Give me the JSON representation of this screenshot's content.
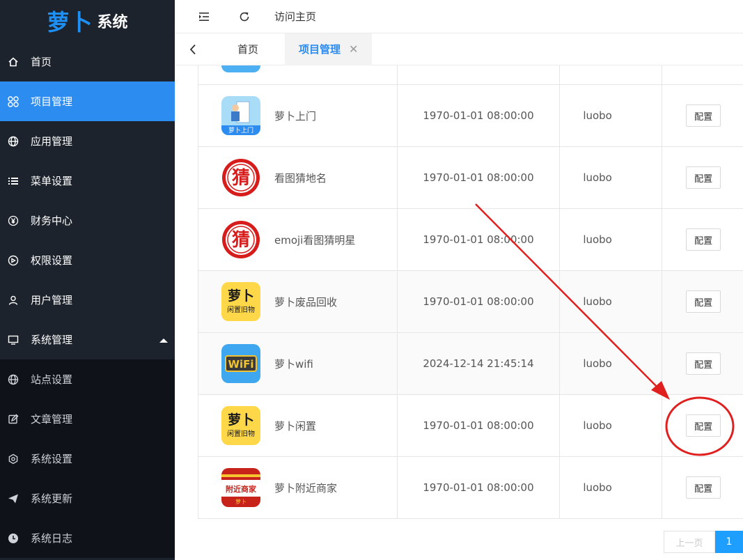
{
  "logo": {
    "mark": "萝卜",
    "text": "系统"
  },
  "sidebar": {
    "items": [
      {
        "label": "首页",
        "icon": "home-icon"
      },
      {
        "label": "项目管理",
        "icon": "grid-icon"
      },
      {
        "label": "应用管理",
        "icon": "globe-icon"
      },
      {
        "label": "菜单设置",
        "icon": "list-icon"
      },
      {
        "label": "财务中心",
        "icon": "yen-icon"
      },
      {
        "label": "权限设置",
        "icon": "dashboard-icon"
      },
      {
        "label": "用户管理",
        "icon": "user-icon"
      },
      {
        "label": "系统管理",
        "icon": "monitor-icon"
      }
    ],
    "submenu": [
      {
        "label": "站点设置",
        "icon": "globe-icon"
      },
      {
        "label": "文章管理",
        "icon": "edit-icon"
      },
      {
        "label": "系统设置",
        "icon": "gear-icon"
      },
      {
        "label": "系统更新",
        "icon": "send-icon"
      },
      {
        "label": "系统日志",
        "icon": "clock-icon"
      }
    ]
  },
  "topbar": {
    "visit_label": "访问主页"
  },
  "tabs": {
    "home": "首页",
    "active": "项目管理",
    "close": "✕"
  },
  "table": {
    "rows": [
      {
        "name": "萝卜上门",
        "time": "1970-01-01 08:00:00",
        "user": "luobo",
        "action": "配置",
        "icon_text": "萝卜上门"
      },
      {
        "name": "看图猜地名",
        "time": "1970-01-01 08:00:00",
        "user": "luobo",
        "action": "配置",
        "icon_text": "猜"
      },
      {
        "name": "emoji看图猜明星",
        "time": "1970-01-01 08:00:00",
        "user": "luobo",
        "action": "配置",
        "icon_text": "猜"
      },
      {
        "name": "萝卜废品回收",
        "time": "1970-01-01 08:00:00",
        "user": "luobo",
        "action": "配置",
        "icon_text": "萝卜",
        "icon_sub": "闲置旧物"
      },
      {
        "name": "萝卜wifi",
        "time": "2024-12-14 21:45:14",
        "user": "luobo",
        "action": "配置",
        "icon_text": "WiFi"
      },
      {
        "name": "萝卜闲置",
        "time": "1970-01-01 08:00:00",
        "user": "luobo",
        "action": "配置",
        "icon_text": "萝卜",
        "icon_sub": "闲置旧物"
      },
      {
        "name": "萝卜附近商家",
        "time": "1970-01-01 08:00:00",
        "user": "luobo",
        "action": "配置",
        "icon_text": "附近商家",
        "icon_sub": "萝卜"
      }
    ]
  },
  "pager": {
    "prev": "上一页",
    "current": "1"
  },
  "colors": {
    "sidebar_bg": "#1d232c",
    "active": "#2d8cf0",
    "annotation": "#e0201f"
  }
}
